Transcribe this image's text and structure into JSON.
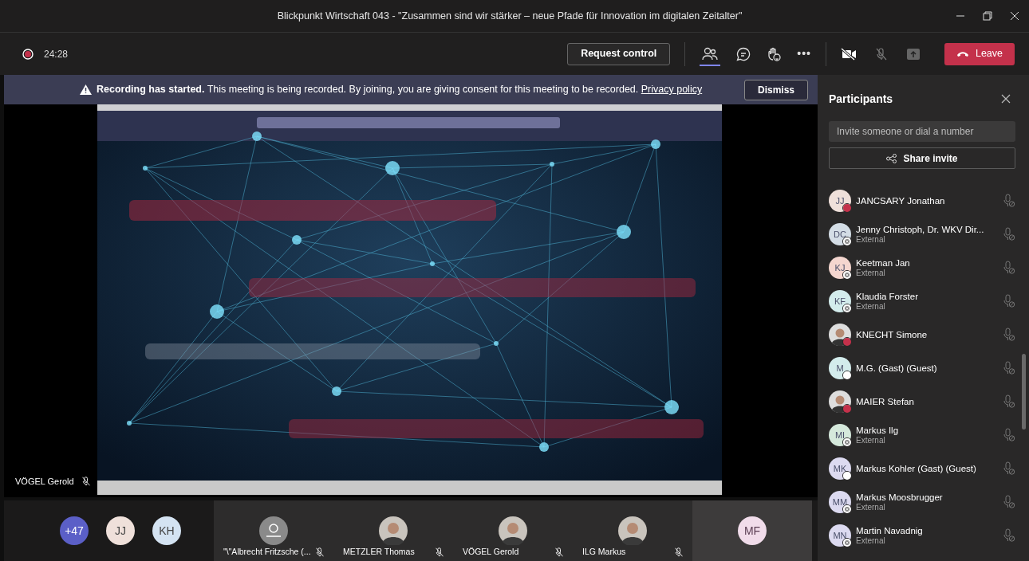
{
  "window": {
    "title": "Blickpunkt Wirtschaft 043 - \"Zusammen sind wir stärker – neue Pfade für Innovation im digitalen Zeitalter\""
  },
  "toolbar": {
    "recording": true,
    "timer": "24:28",
    "request_control": "Request control",
    "more": "•••",
    "leave": "Leave"
  },
  "banner": {
    "title": "Recording has started.",
    "message": "This meeting is being recorded. By joining, you are giving consent for this meeting to be recorded.",
    "link": "Privacy policy",
    "dismiss": "Dismiss"
  },
  "stage": {
    "kind": "picture",
    "presenter": "VÖGEL Gerold",
    "muted": true
  },
  "participants_panel": {
    "title": "Participants",
    "invite": {
      "placeholder": "Invite someone or dial a number"
    },
    "share_invite": "Share invite",
    "items": [
      {
        "kind": "initials",
        "initials": "JJ",
        "color": "#efe0da",
        "name": "JANCSARY Jonathan",
        "presence": {
          "kind": "busy"
        },
        "muted": true
      },
      {
        "kind": "initials",
        "initials": "DC",
        "color": "#d4dde6",
        "name": "Jenny Christoph, Dr. WKV Dir...",
        "subtitle": "External",
        "presence": {
          "kind": "offline"
        },
        "muted": true
      },
      {
        "kind": "initials",
        "initials": "KJ",
        "color": "#f4d6cf",
        "name": "Keetman Jan",
        "subtitle": "External",
        "presence": {
          "kind": "offline"
        },
        "muted": true
      },
      {
        "kind": "initials",
        "initials": "KF",
        "color": "#d3ecec",
        "name": "Klaudia Forster",
        "subtitle": "External",
        "presence": {
          "kind": "offline"
        },
        "muted": true
      },
      {
        "name": "KNECHT Simone",
        "presence": {
          "kind": "busy"
        },
        "muted": true
      },
      {
        "kind": "initials",
        "initials": "M",
        "color": "#d3ecec",
        "name": "M.G. (Gast) (Guest)",
        "presence": {
          "kind": "unknown"
        },
        "muted": true
      },
      {
        "name": "MAIER Stefan",
        "presence": {
          "kind": "busy"
        },
        "muted": true
      },
      {
        "kind": "initials",
        "initials": "MI",
        "color": "#d5e9dc",
        "name": "Markus Ilg",
        "subtitle": "External",
        "presence": {
          "kind": "offline"
        },
        "muted": true
      },
      {
        "kind": "initials",
        "initials": "MK",
        "color": "#dcdaf0",
        "name": "Markus Kohler (Gast) (Guest)",
        "presence": {
          "kind": "unknown"
        },
        "muted": true
      },
      {
        "kind": "initials",
        "initials": "MM",
        "color": "#dcdaf0",
        "name": "Markus Moosbrugger",
        "subtitle": "External",
        "presence": {
          "kind": "offline"
        },
        "muted": true
      },
      {
        "kind": "initials",
        "initials": "MN",
        "color": "#dcdaf0",
        "name": "Martin Navadnig",
        "subtitle": "External",
        "presence": {
          "kind": "offline"
        },
        "muted": true
      }
    ]
  },
  "gallery": {
    "overflow": [
      {
        "label": "+47",
        "color": "#5b5fc7"
      },
      {
        "label": "JJ",
        "color": "#efe0da"
      },
      {
        "label": "KH",
        "color": "#d4e3f2"
      }
    ],
    "tiles": [
      {
        "kind": "generic",
        "name": "\"\\\"Albrecht Fritzsche (...",
        "muted": true
      },
      {
        "name": "METZLER Thomas",
        "muted": true
      },
      {
        "name": "VÖGEL Gerold",
        "muted": true
      },
      {
        "name": "ILG Markus",
        "muted": true
      },
      {
        "kind": "initials",
        "initials": "MF",
        "color": "#f1dcea"
      }
    ]
  }
}
